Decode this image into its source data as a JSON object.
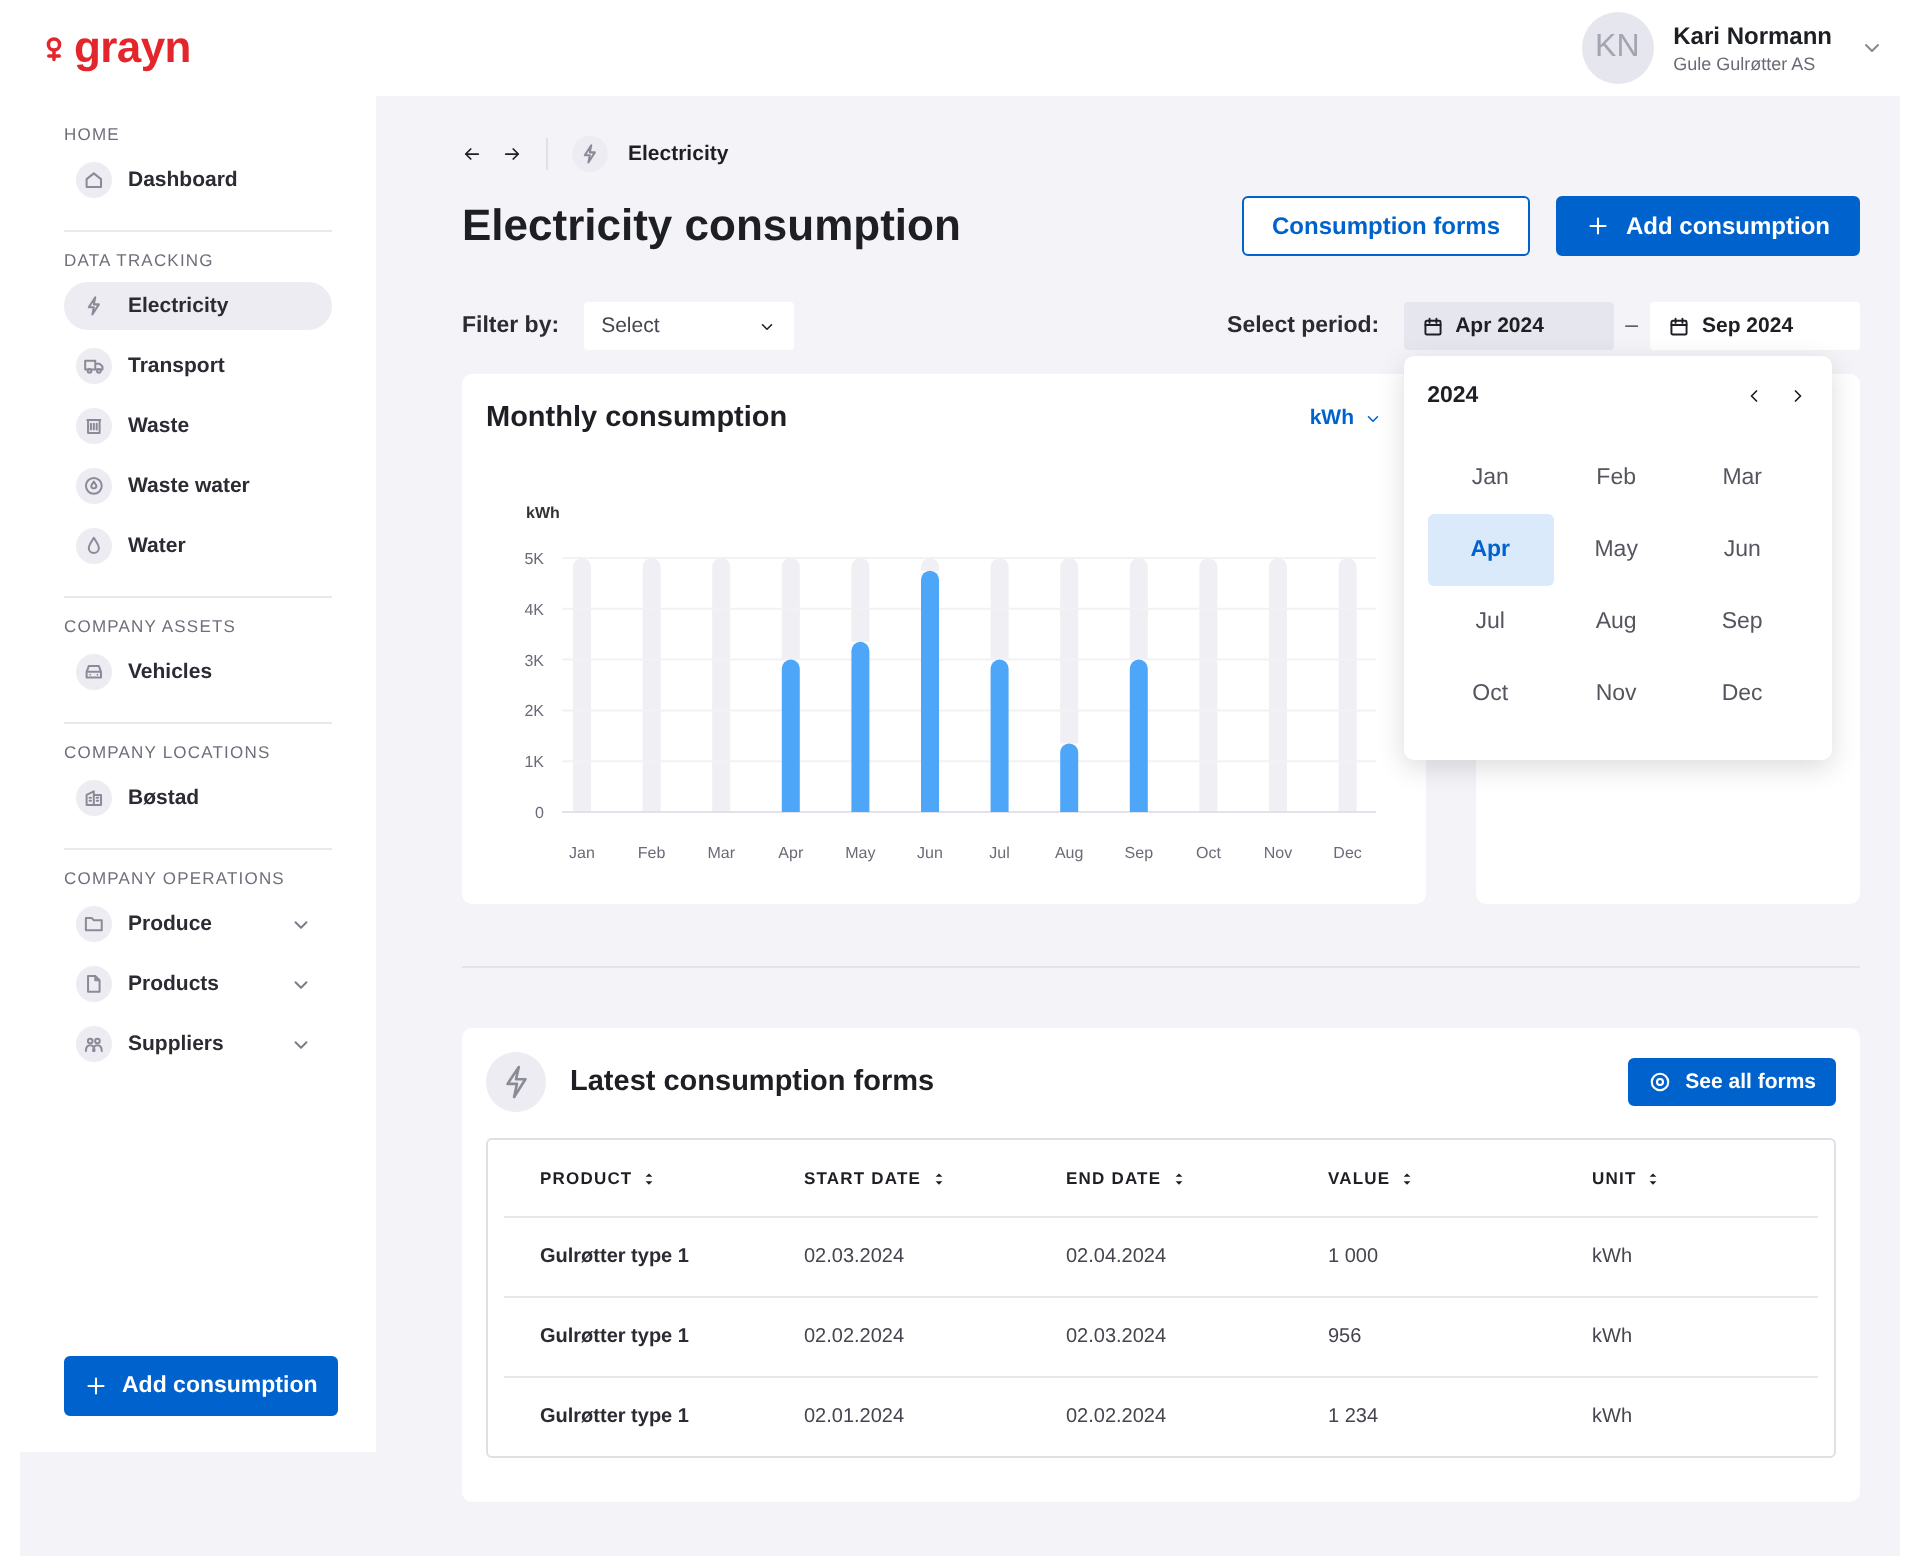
{
  "header": {
    "logo": "grayn",
    "user": {
      "initials": "KN",
      "name": "Kari Normann",
      "company": "Gule Gulrøtter AS"
    }
  },
  "sidebar": {
    "sections": [
      {
        "title": "HOME",
        "items": [
          {
            "label": "Dashboard",
            "kind": "link",
            "selected": false
          }
        ]
      },
      {
        "title": "DATA TRACKING",
        "items": [
          {
            "label": "Electricity",
            "kind": "link",
            "selected": true
          },
          {
            "label": "Transport",
            "kind": "link",
            "selected": false
          },
          {
            "label": "Waste",
            "kind": "link",
            "selected": false
          },
          {
            "label": "Waste water",
            "kind": "link",
            "selected": false
          },
          {
            "label": "Water",
            "kind": "link",
            "selected": false
          }
        ]
      },
      {
        "title": "COMPANY ASSETS",
        "items": [
          {
            "label": "Vehicles",
            "kind": "link",
            "selected": false
          }
        ]
      },
      {
        "title": "COMPANY LOCATIONS",
        "items": [
          {
            "label": "Bøstad",
            "kind": "link",
            "selected": false
          }
        ]
      },
      {
        "title": "COMPANY OPERATIONS",
        "items": [
          {
            "label": "Produce",
            "kind": "group",
            "selected": false
          },
          {
            "label": "Products",
            "kind": "group",
            "selected": false
          },
          {
            "label": "Suppliers",
            "kind": "group",
            "selected": false
          }
        ]
      }
    ],
    "button": "Add consumption"
  },
  "breadcrumb": {
    "label": "Electricity"
  },
  "page_title": "Electricity consumption",
  "actions": [
    {
      "label": "Consumption forms",
      "kind": "outline"
    },
    {
      "label": "Add consumption",
      "kind": "primary"
    }
  ],
  "filter": {
    "label": "Filter by:",
    "placeholder": "Select"
  },
  "period": {
    "label": "Select period:",
    "start": {
      "value": "Apr 2024",
      "active": true
    },
    "separator": "–",
    "end": {
      "value": "Sep 2024",
      "active": false
    }
  },
  "month_picker": {
    "year": "2024",
    "months": [
      {
        "label": "Jan",
        "selected": false
      },
      {
        "label": "Feb",
        "selected": false
      },
      {
        "label": "Mar",
        "selected": false
      },
      {
        "label": "Apr",
        "selected": true
      },
      {
        "label": "May",
        "selected": false
      },
      {
        "label": "Jun",
        "selected": false
      },
      {
        "label": "Jul",
        "selected": false
      },
      {
        "label": "Aug",
        "selected": false
      },
      {
        "label": "Sep",
        "selected": false
      },
      {
        "label": "Oct",
        "selected": false
      },
      {
        "label": "Nov",
        "selected": false
      },
      {
        "label": "Dec",
        "selected": false
      }
    ]
  },
  "chart_card": {
    "title": "Monthly consumption",
    "unit": "kWh",
    "chart_data": {
      "type": "bar",
      "ylabel": "kWh",
      "categories": [
        "Jan",
        "Feb",
        "Mar",
        "Apr",
        "May",
        "Jun",
        "Jul",
        "Aug",
        "Sep",
        "Oct",
        "Nov",
        "Dec"
      ],
      "values": [
        null,
        null,
        null,
        3000,
        3350,
        4750,
        3000,
        1350,
        3000,
        null,
        null,
        null
      ],
      "ylim": [
        0,
        5000
      ],
      "grid": true,
      "yticks": [
        {
          "value": 0,
          "label": "0"
        },
        {
          "value": 1000,
          "label": "1K"
        },
        {
          "value": 2000,
          "label": "2K"
        },
        {
          "value": 3000,
          "label": "3K"
        },
        {
          "value": 4000,
          "label": "4K"
        },
        {
          "value": 5000,
          "label": "5K"
        }
      ]
    }
  },
  "forms": {
    "title": "Latest consumption forms",
    "button": "See all forms",
    "columns": [
      "PRODUCT",
      "START DATE",
      "END DATE",
      "VALUE",
      "UNIT"
    ],
    "rows": [
      [
        "Gulrøtter type 1",
        "02.03.2024",
        "02.04.2024",
        "1 000",
        "kWh"
      ],
      [
        "Gulrøtter type 1",
        "02.02.2024",
        "02.03.2024",
        "956",
        "kWh"
      ],
      [
        "Gulrøtter type 1",
        "02.01.2024",
        "02.02.2024",
        "1 234",
        "kWh"
      ]
    ]
  }
}
